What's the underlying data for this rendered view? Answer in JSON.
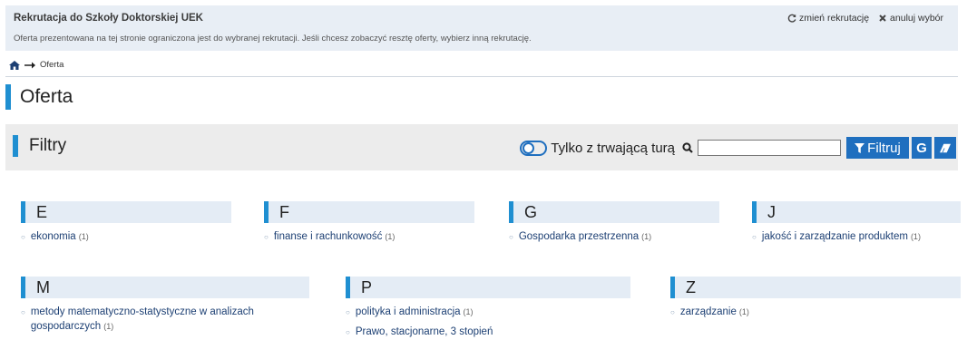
{
  "banner": {
    "title": "Rekrutacja do Szkoły Doktorskiej UEK",
    "text": "Oferta prezentowana na tej stronie ograniczona jest do wybranej rekrutacji. Jeśli chcesz zobaczyć resztę oferty, wybierz inną rekrutację.",
    "change_label": "zmień rekrutację",
    "cancel_label": "anuluj wybór"
  },
  "breadcrumb": {
    "current": "Oferta"
  },
  "page": {
    "title": "Oferta"
  },
  "filters": {
    "title": "Filtry",
    "toggle_label": "Tylko z trwającą turą",
    "search_value": "",
    "filter_button": "Filtruj",
    "g_button": "G"
  },
  "groups": [
    {
      "letter": "E",
      "items": [
        {
          "name": "ekonomia",
          "count": "(1)"
        }
      ]
    },
    {
      "letter": "F",
      "items": [
        {
          "name": "finanse i rachunkowość",
          "count": "(1)"
        }
      ]
    },
    {
      "letter": "G",
      "items": [
        {
          "name": "Gospodarka przestrzenna",
          "count": "(1)"
        }
      ]
    },
    {
      "letter": "J",
      "items": [
        {
          "name": "jakość i zarządzanie produktem",
          "count": "(1)"
        }
      ]
    },
    {
      "letter": "M",
      "items": [
        {
          "name": "metody matematyczno-statystyczne w analizach gospodarczych",
          "count": "(1)"
        }
      ]
    },
    {
      "letter": "P",
      "items": [
        {
          "name": "polityka i administracja",
          "count": "(1)"
        },
        {
          "name": "Prawo, stacjonarne, 3 stopień",
          "count": ""
        }
      ]
    },
    {
      "letter": "Z",
      "items": [
        {
          "name": "zarządzanie",
          "count": "(1)"
        }
      ]
    }
  ],
  "colors": {
    "accent": "#1f8fd1",
    "button": "#1f6fbf",
    "banner_bg": "#e8eef5",
    "filters_bg": "#ececec"
  }
}
